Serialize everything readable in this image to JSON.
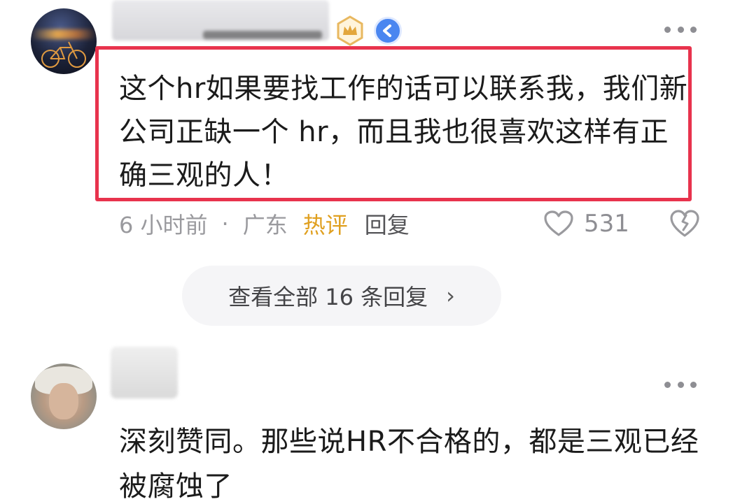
{
  "comment1": {
    "text": "这个hr如果要找工作的话可以联系我，我们新公司正缺一个 hr，而且我也很喜欢这样有正确三观的人！",
    "time": "6 小时前",
    "separator": "·",
    "location": "广东",
    "hot_tag": "热评",
    "reply_label": "回复",
    "like_count": "531",
    "highlight_color": "#e8334d",
    "hot_tag_color": "#e0a020",
    "icons": [
      "crown-badge-icon",
      "verified-badge-icon",
      "more-icon",
      "heart-icon",
      "dislike-heart-icon"
    ]
  },
  "view_replies": {
    "label": "查看全部 16 条回复",
    "chevron": "›"
  },
  "comment2": {
    "text": "深刻赞同。那些说HR不合格的，都是三观已经被腐蚀了"
  }
}
